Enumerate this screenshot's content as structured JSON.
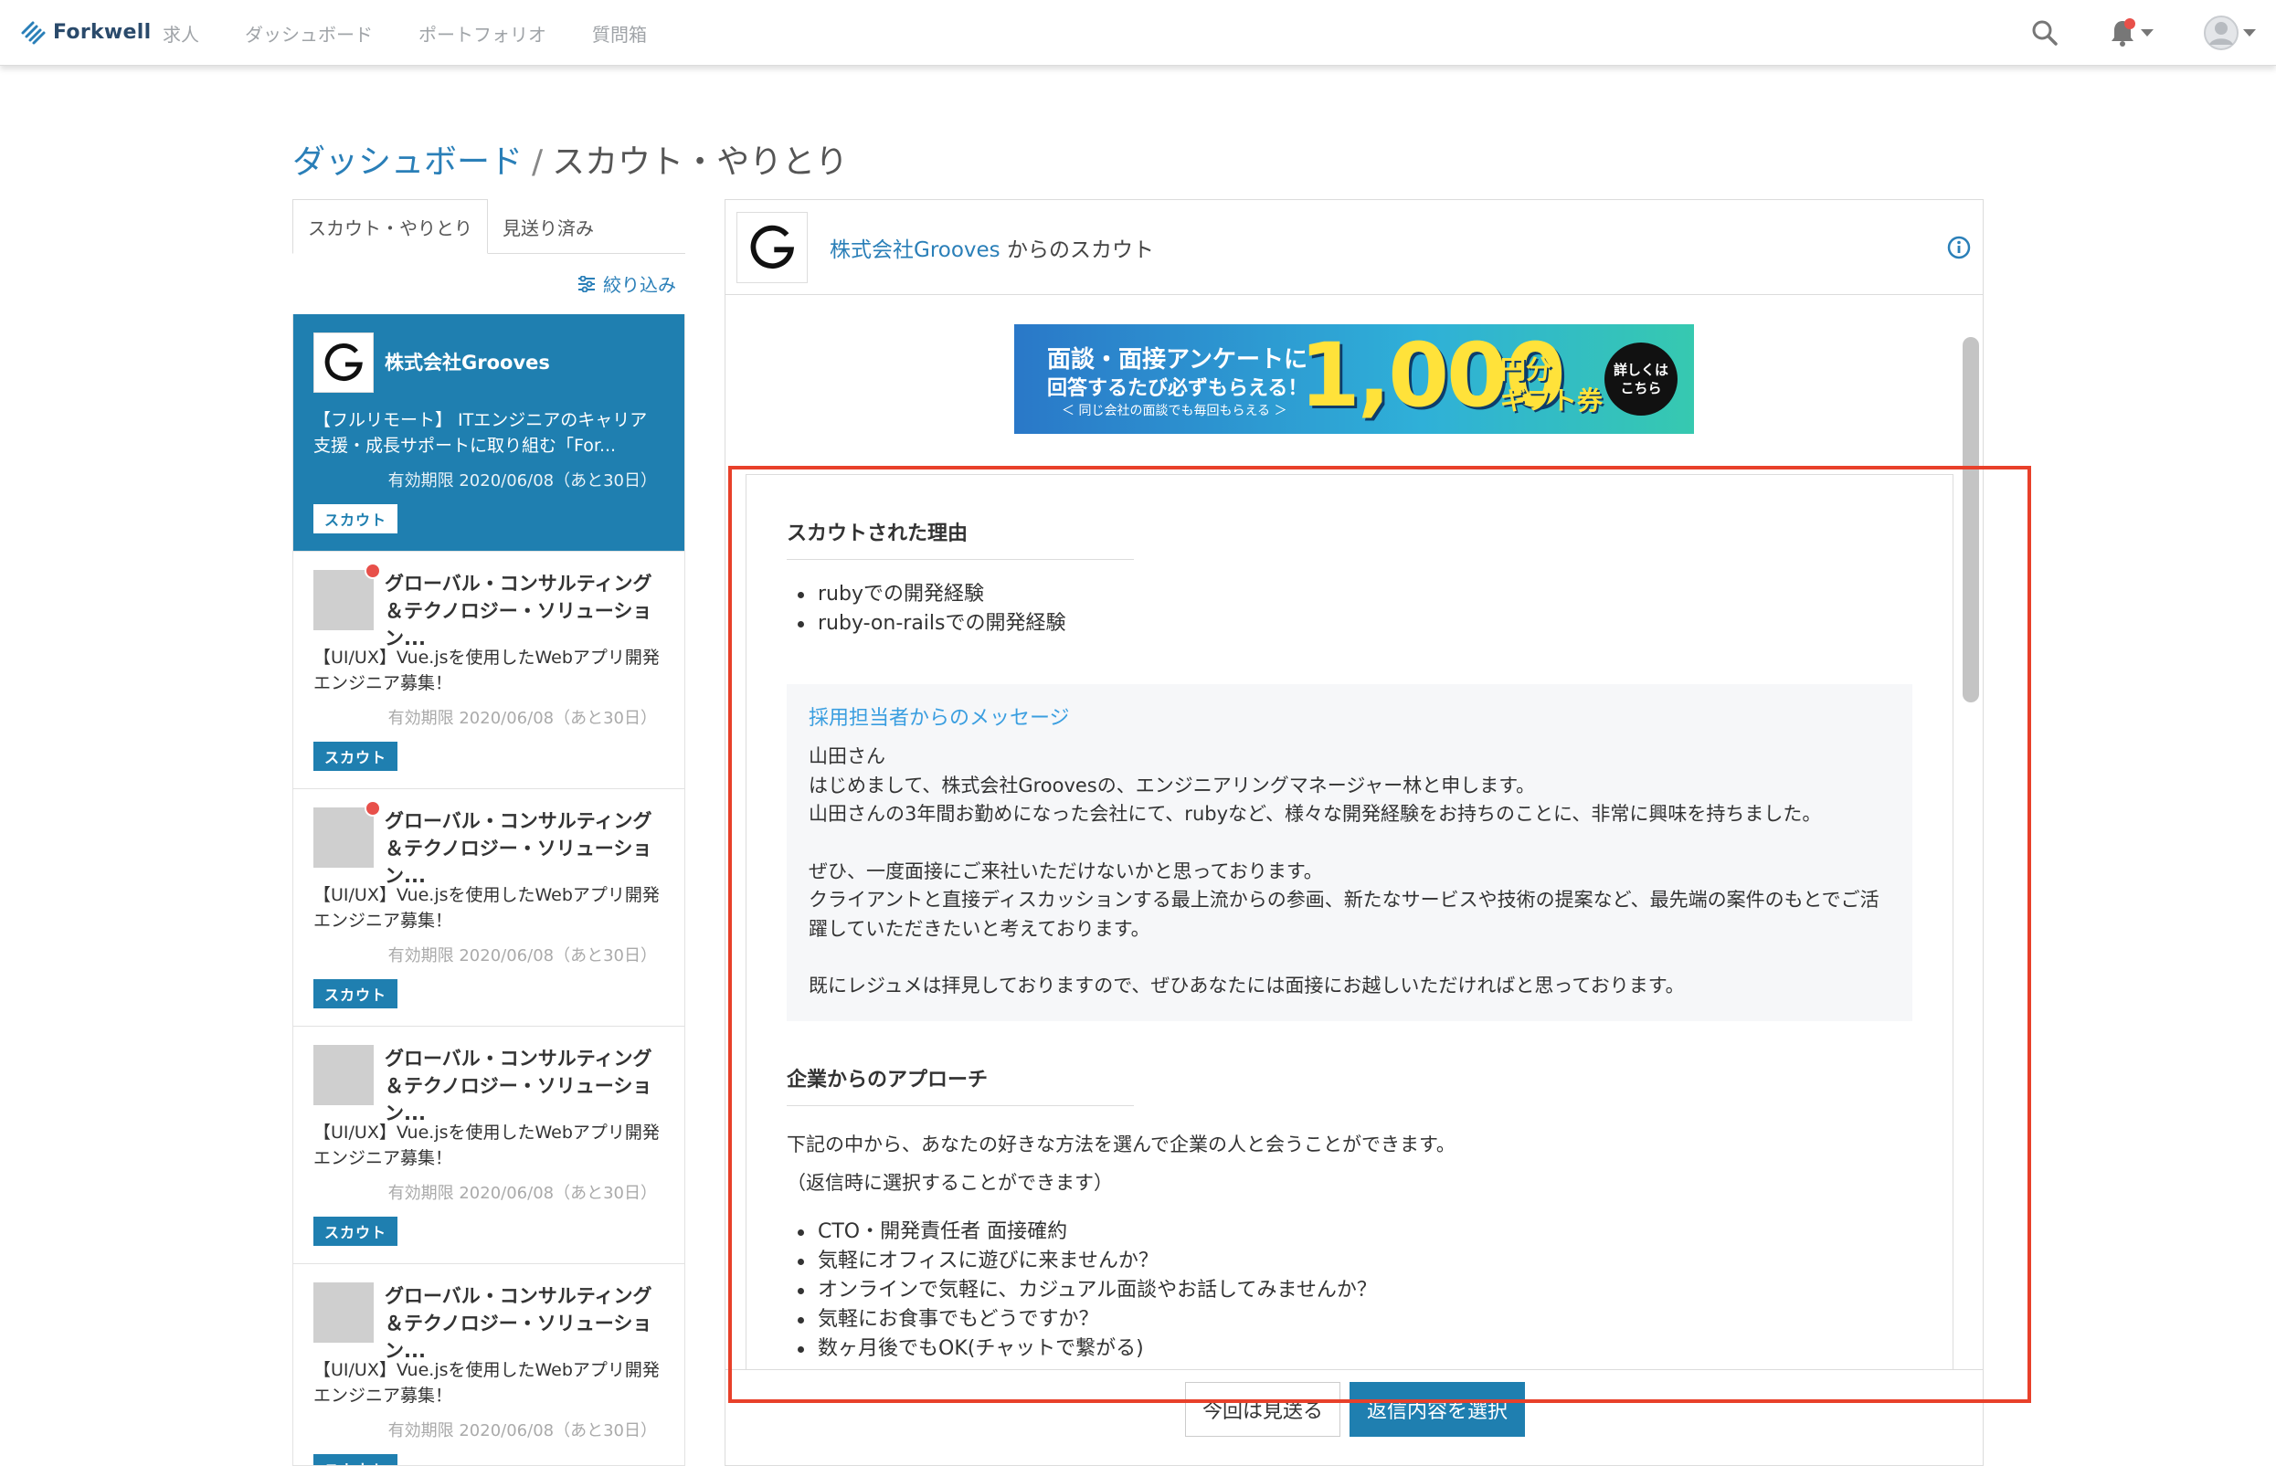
{
  "app": {
    "logo_text": "Forkwell"
  },
  "nav": {
    "items": [
      "求人",
      "ダッシュボード",
      "ポートフォリオ",
      "質問箱"
    ]
  },
  "breadcrumb": {
    "home": "ダッシュボード",
    "separator": "/",
    "current": "スカウト・やりとり"
  },
  "tabs": [
    {
      "label": "スカウト・やりとり",
      "active": true
    },
    {
      "label": "見送り済み",
      "active": false
    }
  ],
  "filter_label": "絞り込み",
  "scouts": [
    {
      "company": "株式会社Grooves",
      "title": "【フルリモート】 ITエンジニアのキャリア支援・成長サポートに取り組む「For...",
      "expire": "有効期限 2020/06/08（あと30日）",
      "badge": "スカウト",
      "active": true,
      "unread": false
    },
    {
      "company": "グローバル・コンサルティング＆テクノロジー・ソリューション...",
      "title": "【UI/UX】Vue.jsを使用したWebアプリ開発エンジニア募集！",
      "expire": "有効期限 2020/06/08（あと30日）",
      "badge": "スカウト",
      "active": false,
      "unread": true
    },
    {
      "company": "グローバル・コンサルティング＆テクノロジー・ソリューション...",
      "title": "【UI/UX】Vue.jsを使用したWebアプリ開発エンジニア募集！",
      "expire": "有効期限 2020/06/08（あと30日）",
      "badge": "スカウト",
      "active": false,
      "unread": true
    },
    {
      "company": "グローバル・コンサルティング＆テクノロジー・ソリューション...",
      "title": "【UI/UX】Vue.jsを使用したWebアプリ開発エンジニア募集！",
      "expire": "有効期限 2020/06/08（あと30日）",
      "badge": "スカウト",
      "active": false,
      "unread": false
    },
    {
      "company": "グローバル・コンサルティング＆テクノロジー・ソリューション...",
      "title": "【UI/UX】Vue.jsを使用したWebアプリ開発エンジニア募集！",
      "expire": "有効期限 2020/06/08（あと30日）",
      "badge": "スカウト",
      "active": false,
      "unread": false
    }
  ],
  "detail": {
    "company_link": "株式会社Grooves",
    "title_suffix": " からのスカウト",
    "banner": {
      "line1": "面談・面接アンケートに",
      "line2": "回答するたび必ずもらえる！",
      "line3": "＜ 同じ会社の面談でも毎回もらえる ＞",
      "amount": "1,000",
      "unit": "円分",
      "unit2": "ギフト券",
      "more_line1": "詳しくは",
      "more_line2": "こちら"
    },
    "reason_title": "スカウトされた理由",
    "reasons": [
      "rubyでの開発経験",
      "ruby-on-railsでの開発経験"
    ],
    "message_heading": "採用担当者からのメッセージ",
    "message_paragraphs": [
      "山田さん\nはじめまして、株式会社Groovesの、エンジニアリングマネージャー林と申します。\n山田さんの3年間お勤めになった会社にて、rubyなど、様々な開発経験をお持ちのことに、非常に興味を持ちました。",
      "ぜひ、一度面接にご来社いただけないかと思っております。\nクライアントと直接ディスカッションする最上流からの参画、新たなサービスや技術の提案など、最先端の案件のもとでご活躍していただきたいと考えております。",
      "既にレジュメは拝見しておりますので、ぜひあなたには面接にお越しいただければと思っております。"
    ],
    "approach_title": "企業からのアプローチ",
    "approach_desc": "下記の中から、あなたの好きな方法を選んで企業の人と会うことができます。",
    "approach_note": "（返信時に選択することができます）",
    "approaches": [
      "CTO・開発責任者 面接確約",
      "気軽にオフィスに遊びに来ませんか？",
      "オンラインで気軽に、カジュアル面談やお話してみませんか？",
      "気軽にお食事でもどうですか？",
      "数ヶ月後でもOK(チャットで繋がる)"
    ],
    "skip_button": "今回は見送る",
    "reply_button": "返信内容を選択"
  },
  "colors": {
    "accent": "#1f7fb0",
    "link": "#2a7fb8",
    "highlight": "#e8402a",
    "unread": "#e8504a"
  },
  "icons": {
    "search": "search-icon",
    "bell": "bell-icon",
    "avatar": "avatar-icon",
    "info": "info-icon",
    "filter": "filter-icon"
  }
}
